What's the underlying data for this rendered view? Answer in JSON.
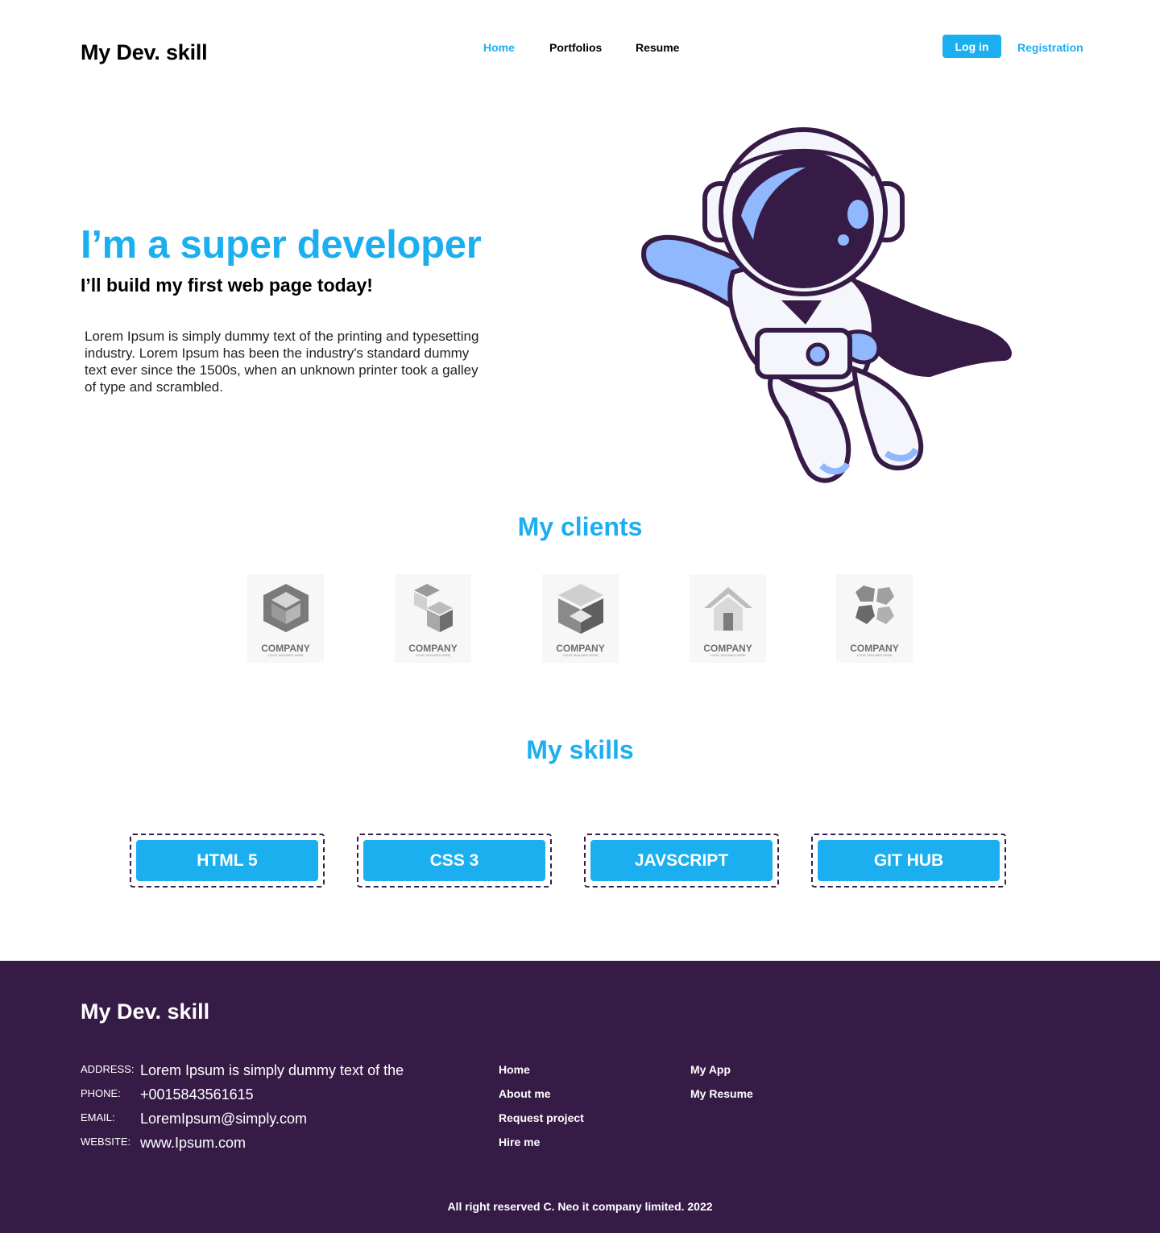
{
  "header": {
    "logo": "My Dev. skill",
    "nav": [
      "Home",
      "Portfolios",
      "Resume"
    ],
    "login": "Log in",
    "registration": "Registration"
  },
  "hero": {
    "title": "I’m a super developer",
    "subtitle": "I’ll build my first web page today!",
    "text": "Lorem Ipsum is simply dummy text of the printing and typesetting industry. Lorem Ipsum has been the industry's standard dummy text ever since the 1500s, when an unknown printer took a galley of type and scrambled."
  },
  "clients": {
    "title": "My clients",
    "items": [
      {
        "name": "COMPANY",
        "tagline": "YOUR TAGLINES HERE"
      },
      {
        "name": "COMPANY",
        "tagline": "YOUR TAGLINES HERE"
      },
      {
        "name": "COMPANY",
        "tagline": "YOUR TAGLINES HERE"
      },
      {
        "name": "COMPANY",
        "tagline": "YOUR TAGLINES HERE"
      },
      {
        "name": "COMPANY",
        "tagline": "YOUR TAGLINES HERE"
      }
    ]
  },
  "skills": {
    "title": "My skills",
    "items": [
      "HTML 5",
      "CSS 3",
      "JAVSCRIPT",
      "GIT HUB"
    ]
  },
  "footer": {
    "logo": "My Dev. skill",
    "contact": [
      {
        "label": "ADDRESS:",
        "value": "Lorem Ipsum is simply dummy text of the"
      },
      {
        "label": "PHONE:",
        "value": "+0015843561615"
      },
      {
        "label": "EMAIL:",
        "value": "LoremIpsum@simply.com"
      },
      {
        "label": "WEBSITE:",
        "value": "www.Ipsum.com"
      }
    ],
    "links_col1": [
      "Home",
      "About me",
      "Request project",
      "Hire me"
    ],
    "links_col2": [
      "My App",
      "My Resume"
    ],
    "copyright": "All right reserved C. Neo it company limited. 2022"
  },
  "colors": {
    "accent": "#1BAFF0",
    "footer_bg": "#371B47",
    "astronaut_outline": "#371B47",
    "astronaut_light": "#8FB8FF"
  }
}
